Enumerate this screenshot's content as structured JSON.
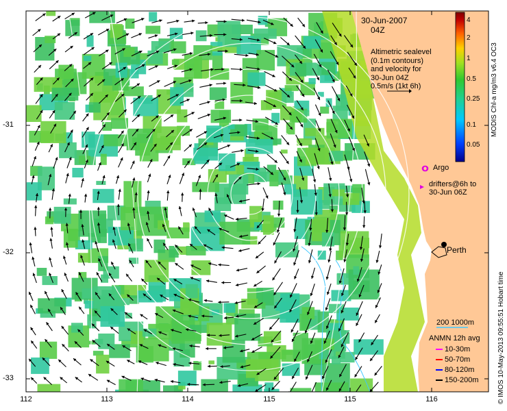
{
  "header": {
    "date": "30-Jun-2007",
    "time": "04Z"
  },
  "note": {
    "line1": "Altimetric sealevel",
    "line2": "(0.1m contours)",
    "line3": "and velocity for",
    "line4": "30-Jun 04Z",
    "line5": "0.5m/s (1kt 6h)"
  },
  "legend": {
    "argo": "Argo",
    "drifters_line1": "drifters@6h to",
    "drifters_line2": "30-Jun 06Z",
    "bathy": "200  1000m",
    "anmn_title": "ANMN 12h avg",
    "anmn_items": [
      {
        "label": "10-30m",
        "color": "#ff00ff"
      },
      {
        "label": "50-70m",
        "color": "#ff0000"
      },
      {
        "label": "80-120m",
        "color": "#0000ff"
      },
      {
        "label": "150-200m",
        "color": "#000000"
      }
    ]
  },
  "city": "Perth",
  "colorbar": {
    "title": "MODIS Chl-a mg/m3 v6.4 OC3",
    "ticks": [
      "4",
      "2",
      "1",
      "0.5",
      "0.25",
      "0.1",
      "0.05"
    ]
  },
  "axes": {
    "x_ticks": [
      "112",
      "113",
      "114",
      "115",
      "116"
    ],
    "y_ticks": [
      "-31",
      "-32",
      "-33"
    ]
  },
  "credit": "© IMOS 10-May-2013 09:55:51 Hobart time",
  "colors": {
    "land": "#ffc896",
    "ocean_green": "#4cc850",
    "ocean_cyan": "#30c8a0",
    "coast_yellow": "#c8dc30",
    "contour": "#ffffff",
    "bathy": "#40c8ff"
  }
}
